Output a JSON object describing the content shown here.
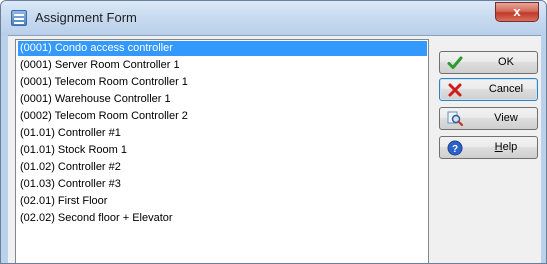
{
  "window": {
    "title": "Assignment Form",
    "close_glyph": "x"
  },
  "list": {
    "selected_index": 0,
    "items": [
      "(0001) Condo access controller",
      "(0001) Server Room Controller 1",
      "(0001) Telecom Room Controller 1",
      "(0001) Warehouse Controller 1",
      "(0002) Telecom Room Controller 2",
      "(01.01) Controller #1",
      "(01.01) Stock Room 1",
      "(01.02) Controller #2",
      "(01.03) Controller #3",
      "(02.01) First Floor",
      "(02.02) Second floor + Elevator"
    ]
  },
  "buttons": {
    "ok": {
      "label": "OK",
      "icon": "checkmark-icon"
    },
    "cancel": {
      "label": "Cancel",
      "icon": "x-mark-icon"
    },
    "view": {
      "label": "View",
      "icon": "magnifier-icon"
    },
    "help": {
      "label_prefix": "",
      "label_underlined": "H",
      "label_rest": "elp",
      "icon": "help-icon"
    }
  },
  "colors": {
    "selection": "#3399ff",
    "title_bar": "#c7daf0",
    "close_button": "#c0392b"
  }
}
